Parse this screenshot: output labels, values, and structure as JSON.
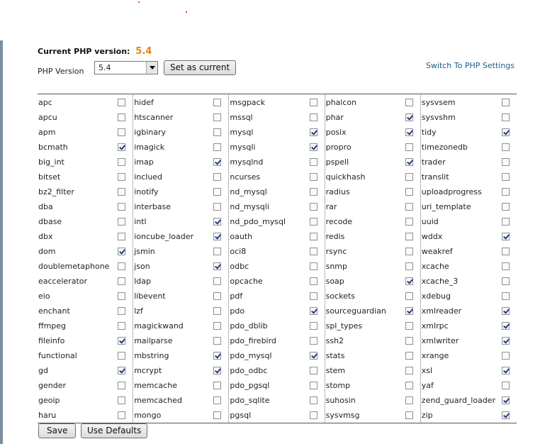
{
  "current": {
    "label": "Current PHP version:",
    "version": "5.4"
  },
  "selector": {
    "label": "PHP Version",
    "selected": "5.4",
    "set_button": "Set as current"
  },
  "switch_link": "Switch To PHP Settings",
  "columns": [
    [
      {
        "name": "apc",
        "checked": false
      },
      {
        "name": "apcu",
        "checked": false
      },
      {
        "name": "apm",
        "checked": false
      },
      {
        "name": "bcmath",
        "checked": true
      },
      {
        "name": "big_int",
        "checked": false
      },
      {
        "name": "bitset",
        "checked": false
      },
      {
        "name": "bz2_filter",
        "checked": false
      },
      {
        "name": "dba",
        "checked": false
      },
      {
        "name": "dbase",
        "checked": false
      },
      {
        "name": "dbx",
        "checked": false
      },
      {
        "name": "dom",
        "checked": true
      },
      {
        "name": "doublemetaphone",
        "checked": false
      },
      {
        "name": "eaccelerator",
        "checked": false
      },
      {
        "name": "eio",
        "checked": false
      },
      {
        "name": "enchant",
        "checked": false
      },
      {
        "name": "ffmpeg",
        "checked": false
      },
      {
        "name": "fileinfo",
        "checked": true
      },
      {
        "name": "functional",
        "checked": false
      },
      {
        "name": "gd",
        "checked": true
      },
      {
        "name": "gender",
        "checked": false
      },
      {
        "name": "geoip",
        "checked": false
      },
      {
        "name": "haru",
        "checked": false
      }
    ],
    [
      {
        "name": "hidef",
        "checked": false
      },
      {
        "name": "htscanner",
        "checked": false
      },
      {
        "name": "igbinary",
        "checked": false
      },
      {
        "name": "imagick",
        "checked": false
      },
      {
        "name": "imap",
        "checked": true
      },
      {
        "name": "inclued",
        "checked": false
      },
      {
        "name": "inotify",
        "checked": false
      },
      {
        "name": "interbase",
        "checked": false
      },
      {
        "name": "intl",
        "checked": true
      },
      {
        "name": "ioncube_loader",
        "checked": true
      },
      {
        "name": "jsmin",
        "checked": false
      },
      {
        "name": "json",
        "checked": true
      },
      {
        "name": "ldap",
        "checked": false
      },
      {
        "name": "libevent",
        "checked": false
      },
      {
        "name": "lzf",
        "checked": false
      },
      {
        "name": "magickwand",
        "checked": false
      },
      {
        "name": "mailparse",
        "checked": false
      },
      {
        "name": "mbstring",
        "checked": true
      },
      {
        "name": "mcrypt",
        "checked": true
      },
      {
        "name": "memcache",
        "checked": false
      },
      {
        "name": "memcached",
        "checked": false
      },
      {
        "name": "mongo",
        "checked": false
      }
    ],
    [
      {
        "name": "msgpack",
        "checked": false
      },
      {
        "name": "mssql",
        "checked": false
      },
      {
        "name": "mysql",
        "checked": true
      },
      {
        "name": "mysqli",
        "checked": true
      },
      {
        "name": "mysqlnd",
        "checked": false
      },
      {
        "name": "ncurses",
        "checked": false
      },
      {
        "name": "nd_mysql",
        "checked": false
      },
      {
        "name": "nd_mysqli",
        "checked": false
      },
      {
        "name": "nd_pdo_mysql",
        "checked": false
      },
      {
        "name": "oauth",
        "checked": false
      },
      {
        "name": "oci8",
        "checked": false
      },
      {
        "name": "odbc",
        "checked": false
      },
      {
        "name": "opcache",
        "checked": false
      },
      {
        "name": "pdf",
        "checked": false
      },
      {
        "name": "pdo",
        "checked": true
      },
      {
        "name": "pdo_dblib",
        "checked": false
      },
      {
        "name": "pdo_firebird",
        "checked": false
      },
      {
        "name": "pdo_mysql",
        "checked": true
      },
      {
        "name": "pdo_odbc",
        "checked": false
      },
      {
        "name": "pdo_pgsql",
        "checked": false
      },
      {
        "name": "pdo_sqlite",
        "checked": false
      },
      {
        "name": "pgsql",
        "checked": false
      }
    ],
    [
      {
        "name": "phalcon",
        "checked": false
      },
      {
        "name": "phar",
        "checked": true
      },
      {
        "name": "posix",
        "checked": true
      },
      {
        "name": "propro",
        "checked": false
      },
      {
        "name": "pspell",
        "checked": true
      },
      {
        "name": "quickhash",
        "checked": false
      },
      {
        "name": "radius",
        "checked": false
      },
      {
        "name": "rar",
        "checked": false
      },
      {
        "name": "recode",
        "checked": false
      },
      {
        "name": "redis",
        "checked": false
      },
      {
        "name": "rsync",
        "checked": false
      },
      {
        "name": "snmp",
        "checked": false
      },
      {
        "name": "soap",
        "checked": true
      },
      {
        "name": "sockets",
        "checked": false
      },
      {
        "name": "sourceguardian",
        "checked": true
      },
      {
        "name": "spl_types",
        "checked": false
      },
      {
        "name": "ssh2",
        "checked": false
      },
      {
        "name": "stats",
        "checked": false
      },
      {
        "name": "stem",
        "checked": false
      },
      {
        "name": "stomp",
        "checked": false
      },
      {
        "name": "suhosin",
        "checked": false
      },
      {
        "name": "sysvmsg",
        "checked": false
      }
    ],
    [
      {
        "name": "sysvsem",
        "checked": false
      },
      {
        "name": "sysvshm",
        "checked": false
      },
      {
        "name": "tidy",
        "checked": true
      },
      {
        "name": "timezonedb",
        "checked": false
      },
      {
        "name": "trader",
        "checked": false
      },
      {
        "name": "translit",
        "checked": false
      },
      {
        "name": "uploadprogress",
        "checked": false
      },
      {
        "name": "uri_template",
        "checked": false
      },
      {
        "name": "uuid",
        "checked": false
      },
      {
        "name": "wddx",
        "checked": true
      },
      {
        "name": "weakref",
        "checked": false
      },
      {
        "name": "xcache",
        "checked": false
      },
      {
        "name": "xcache_3",
        "checked": false
      },
      {
        "name": "xdebug",
        "checked": false
      },
      {
        "name": "xmlreader",
        "checked": true
      },
      {
        "name": "xmlrpc",
        "checked": true
      },
      {
        "name": "xmlwriter",
        "checked": true
      },
      {
        "name": "xrange",
        "checked": false
      },
      {
        "name": "xsl",
        "checked": true
      },
      {
        "name": "yaf",
        "checked": false
      },
      {
        "name": "zend_guard_loader",
        "checked": true
      },
      {
        "name": "zip",
        "checked": true
      }
    ]
  ],
  "actions": {
    "save": "Save",
    "defaults": "Use Defaults"
  },
  "colors": {
    "version_accent": "#e8830c",
    "link": "#1a5e8a",
    "check": "#1f3a93"
  }
}
